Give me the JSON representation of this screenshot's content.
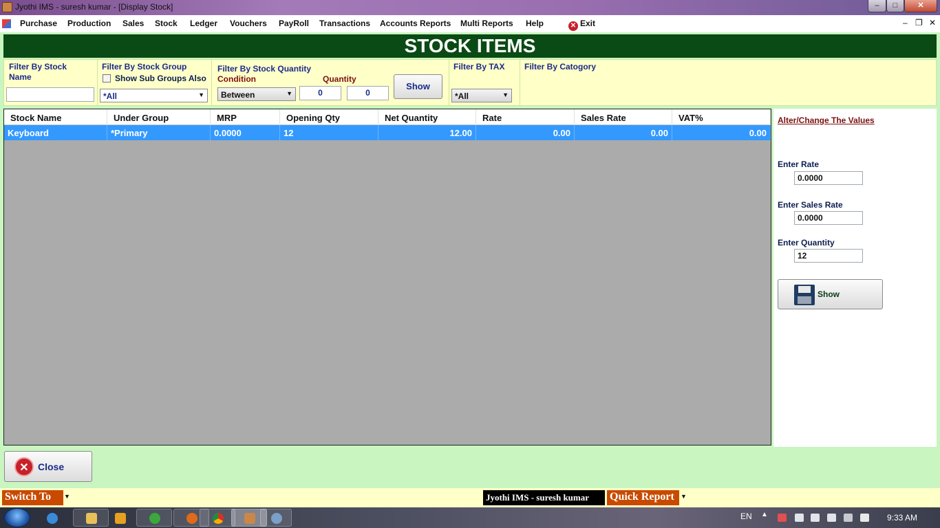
{
  "window": {
    "title": "Jyothi IMS - suresh kumar - [Display Stock]",
    "min_glyph": "–",
    "max_glyph": "□",
    "close_glyph": "✕"
  },
  "menu": {
    "items": [
      "Purchase",
      "Production",
      "Sales",
      "Stock",
      "Ledger",
      "Vouchers",
      "PayRoll",
      "Transactions",
      "Accounts Reports",
      "Multi Reports",
      "Help"
    ],
    "exit_label": "Exit",
    "mdi_min": "–",
    "mdi_restore": "❐",
    "mdi_close": "✕"
  },
  "header": {
    "title": "STOCK ITEMS"
  },
  "filters": {
    "stock_name_label": "Filter By Stock Name",
    "stock_name_value": "",
    "stock_group_label": "Filter By Stock Group",
    "show_sub_groups_label": "Show Sub Groups Also",
    "show_sub_groups_checked": false,
    "stock_group_value": "*All",
    "quantity_label": "Filter By Stock Quantity",
    "condition_label": "Condition",
    "condition_value": "Between",
    "quantity_sub_label": "Quantity",
    "qty_from": "0",
    "qty_to": "0",
    "show_label": "Show",
    "tax_label": "Filter By TAX",
    "tax_value": "*All",
    "category_label": "Filter By Catogory"
  },
  "grid": {
    "columns": [
      "Stock Name",
      "Under Group",
      "MRP",
      "Opening Qty",
      "Net Quantity",
      "Rate",
      "Sales Rate",
      "VAT%"
    ],
    "rows": [
      [
        "Keyboard",
        "*Primary",
        "0.0000",
        "12",
        "12.00",
        "0.00",
        "0.00",
        "0.00"
      ]
    ],
    "selected_row": 0,
    "selection_color": "#3399ff"
  },
  "side": {
    "alter_link": "Alter/Change The Values",
    "rate_label": "Enter Rate",
    "rate_value": "0.0000",
    "sales_rate_label": "Enter Sales Rate",
    "sales_rate_value": "0.0000",
    "quantity_label": "Enter Quantity",
    "quantity_value": "12",
    "show_label": "Show"
  },
  "actions": {
    "close_label": "Close"
  },
  "bottom_bar": {
    "switch_to_label": "Switch To",
    "user_label": "Jyothi IMS - suresh kumar",
    "quick_report_label": "Quick Report"
  },
  "taskbar": {
    "items": [
      "internet-explorer",
      "file-explorer",
      "media-player",
      "utorrent",
      "firefox",
      "chrome",
      "jyothi-ims",
      "paint"
    ],
    "active_item": "jyothi-ims",
    "language": "EN",
    "clock": "9:33 AM"
  },
  "colors": {
    "header_bg": "#0a4a14",
    "filter_bg": "#ffffc8",
    "accent_orange": "#c84a00",
    "selection": "#3399ff"
  }
}
